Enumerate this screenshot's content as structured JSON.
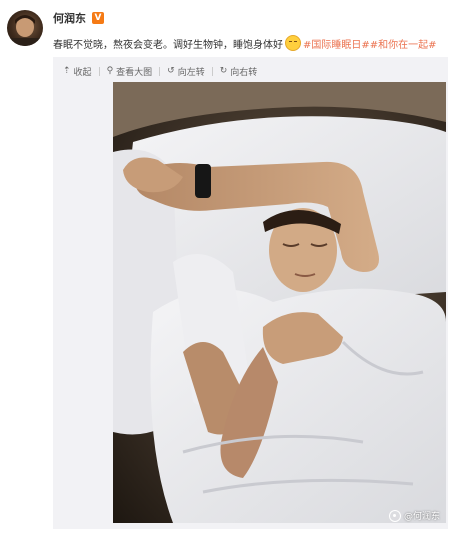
{
  "user": {
    "name": "何润东",
    "verified_badge": "V"
  },
  "post": {
    "text": "春眠不觉晓，熬夜会变老。调好生物钟，睡饱身体好",
    "emoji": "sleepy-face-emoji",
    "hashtag1": "#国际睡眠日#",
    "hashtag2": "#和你在一起#",
    "hashtag_color": "#eb7350"
  },
  "toolbar": {
    "collapse_label": "收起",
    "view_large_label": "查看大图",
    "rotate_left_label": "向左转",
    "rotate_right_label": "向右转"
  },
  "media": {
    "watermark": "@何润东"
  },
  "colors": {
    "badge": "#f57a14",
    "panel_bg": "#f2f2f5"
  }
}
